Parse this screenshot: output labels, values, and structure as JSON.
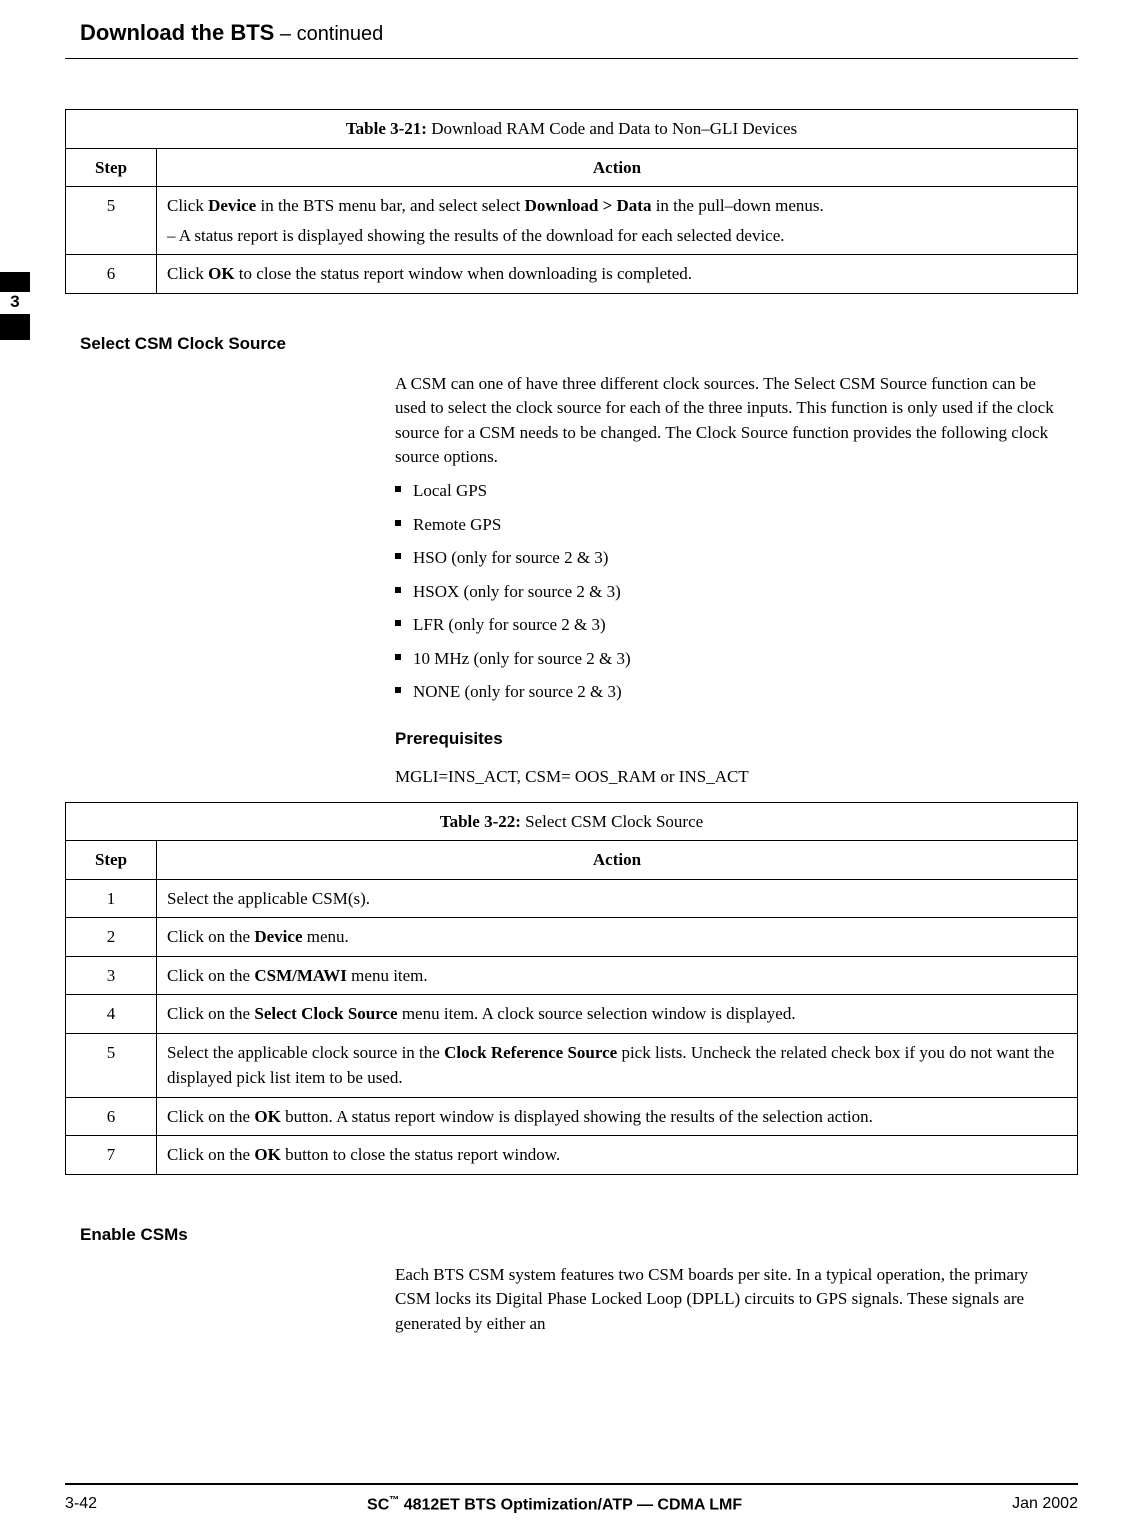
{
  "header": {
    "title": "Download the BTS",
    "continued": " – continued"
  },
  "side_tab": {
    "number": "3"
  },
  "table1": {
    "caption_label": "Table 3-21:",
    "caption_text": " Download RAM Code and Data to Non–GLI Devices",
    "head_step": "Step",
    "head_action": "Action",
    "rows": [
      {
        "step": "5",
        "action_pre": "Click ",
        "b1": "Device",
        "mid1": " in the BTS menu bar, and select select ",
        "b2": "Download > Data",
        "mid2": " in the pull–down menus.",
        "sub": "–  A status report is displayed showing the results of the download for each selected device."
      },
      {
        "step": "6",
        "action_pre": "Click ",
        "b1": "OK",
        "mid1": " to close the status report window when downloading is completed.",
        "b2": "",
        "mid2": "",
        "sub": ""
      }
    ]
  },
  "section1": {
    "heading": "Select CSM Clock Source",
    "para": "A CSM can one of have three different clock sources. The Select CSM Source function can be used to select the clock source for each of the three inputs. This function is only used if the clock source for a CSM needs to be changed. The Clock Source function provides the following clock source options.",
    "options": [
      "Local GPS",
      "Remote GPS",
      "HSO (only for source 2 & 3)",
      "HSOX (only for source 2 & 3)",
      "LFR (only for source 2 & 3)",
      "10 MHz (only for source 2 & 3)",
      "NONE (only for source 2 & 3)"
    ],
    "prereq_heading": "Prerequisites",
    "prereq_text": "MGLI=INS_ACT, CSM= OOS_RAM or INS_ACT"
  },
  "table2": {
    "caption_label": "Table 3-22:",
    "caption_text": " Select CSM Clock Source",
    "head_step": "Step",
    "head_action": "Action",
    "rows": [
      {
        "step": "1",
        "pre": "Select the applicable CSM(s).",
        "b1": "",
        "post1": "",
        "b2": "",
        "post2": ""
      },
      {
        "step": "2",
        "pre": "Click on the ",
        "b1": "Device",
        "post1": " menu.",
        "b2": "",
        "post2": ""
      },
      {
        "step": "3",
        "pre": "Click on the ",
        "b1": "CSM/MAWI",
        "post1": " menu item.",
        "b2": "",
        "post2": ""
      },
      {
        "step": "4",
        "pre": "Click on the ",
        "b1": "Select Clock Source",
        "post1": " menu item. A clock source selection window is displayed.",
        "b2": "",
        "post2": ""
      },
      {
        "step": "5",
        "pre": "Select the applicable clock source in the ",
        "b1": "Clock Reference Source",
        "post1": " pick lists. Uncheck the related check box if you do not want the displayed pick list item to be used.",
        "b2": "",
        "post2": ""
      },
      {
        "step": "6",
        "pre": "Click on the ",
        "b1": "OK",
        "post1": " button. A status report window is displayed showing the results of the selection action.",
        "b2": "",
        "post2": ""
      },
      {
        "step": "7",
        "pre": "Click on the ",
        "b1": "OK",
        "post1": " button to close the status report window.",
        "b2": "",
        "post2": ""
      }
    ]
  },
  "section2": {
    "heading": "Enable CSMs",
    "para": "Each BTS CSM system features two CSM boards per site. In a typical operation, the primary CSM locks its Digital Phase Locked Loop (DPLL) circuits to GPS signals. These signals are generated by either an"
  },
  "footer": {
    "left": "3-42",
    "center_pre": "SC",
    "center_tm": "™",
    "center_post": " 4812ET BTS Optimization/ATP — CDMA LMF",
    "right": "Jan 2002"
  }
}
